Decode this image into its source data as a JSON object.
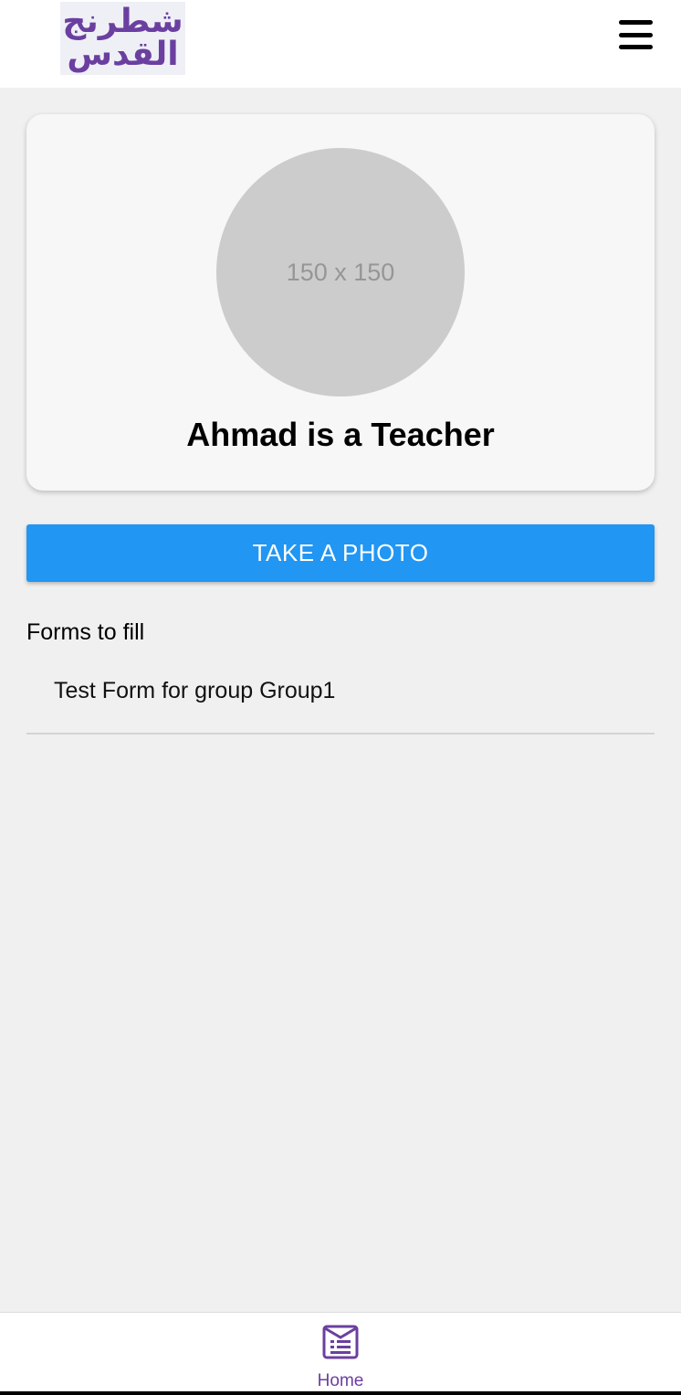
{
  "header": {
    "logo_line1": "شطرنج",
    "logo_line2": "القدس",
    "menu_icon": "hamburger-menu-icon"
  },
  "profile": {
    "avatar_placeholder": "150 x 150",
    "title": "Ahmad is a Teacher"
  },
  "actions": {
    "take_photo_label": "TAKE A PHOTO"
  },
  "forms": {
    "section_title": "Forms to fill",
    "items": [
      {
        "label": "Test Form for group Group1"
      }
    ]
  },
  "bottom_nav": {
    "items": [
      {
        "label": "Home",
        "icon": "form-list-icon"
      }
    ]
  },
  "colors": {
    "brand_purple": "#6b3fa0",
    "primary_button": "#2196f3",
    "page_background": "#f0f0f0",
    "card_background": "#f7f7f7"
  }
}
